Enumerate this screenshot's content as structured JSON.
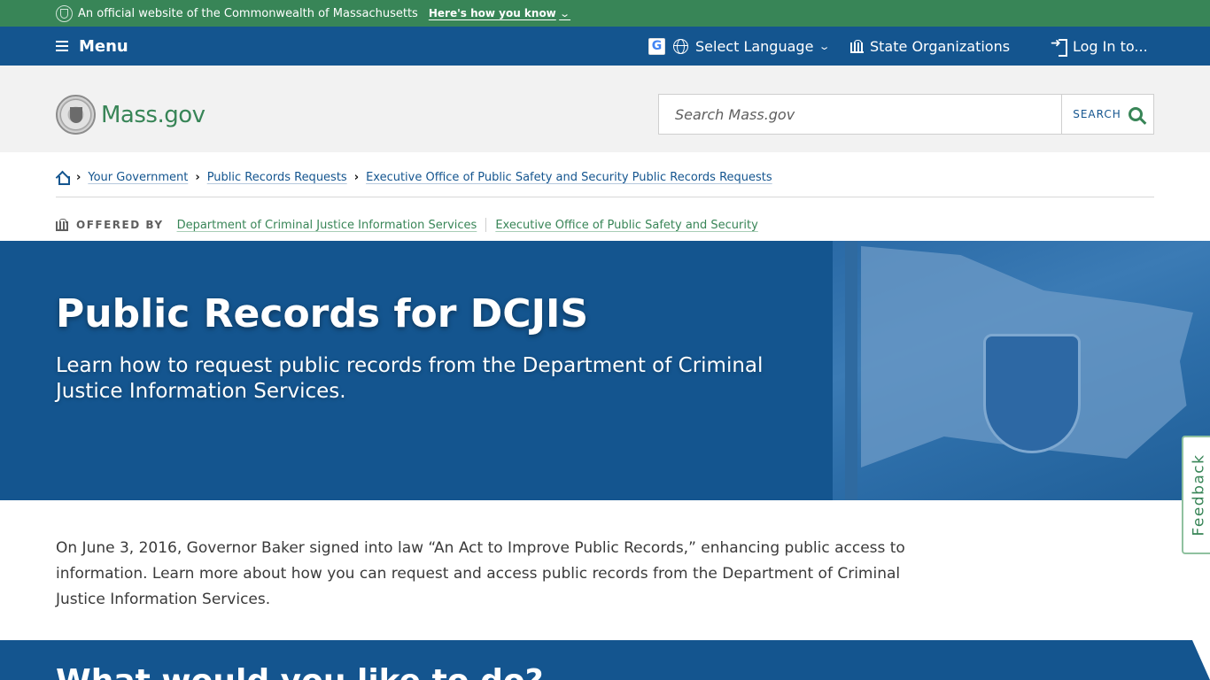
{
  "official_banner": {
    "text": "An official website of the Commonwealth of Massachusetts",
    "link": "Here's how you know"
  },
  "utility_nav": {
    "menu": "Menu",
    "language": "Select Language",
    "state_orgs": "State Organizations",
    "login": "Log In to..."
  },
  "header": {
    "logo_text": "Mass.gov",
    "search_placeholder": "Search Mass.gov",
    "search_button": "SEARCH"
  },
  "breadcrumbs": [
    "Your Government",
    "Public Records Requests",
    "Executive Office of Public Safety and Security Public Records Requests"
  ],
  "offered_by": {
    "label": "OFFERED BY",
    "orgs": [
      "Department of Criminal Justice Information Services",
      "Executive Office of Public Safety and Security"
    ]
  },
  "hero": {
    "title": "Public Records for DCJIS",
    "subtitle": "Learn how to request public records from the Department of Criminal Justice Information Services."
  },
  "intro": "On June 3, 2016, Governor Baker signed into law “An Act to Improve Public Records,” enhancing public access to information. Learn more about how you can request and access public records from the Department of Criminal Justice Information Services.",
  "next_section": {
    "title": "What would you like to do?"
  },
  "feedback": "Feedback",
  "colors": {
    "brand_green": "#388557",
    "brand_blue": "#14558f",
    "header_gray": "#f2f2f2"
  }
}
